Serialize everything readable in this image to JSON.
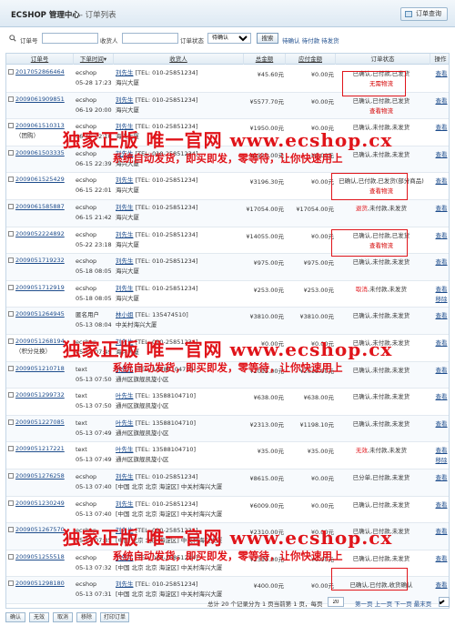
{
  "header": {
    "title": "ECSHOP 管理中心",
    "subtitle": "- 订单列表",
    "list_button": "订单查询"
  },
  "search": {
    "order_sn_label": "订单号",
    "consignee_label": "收货人",
    "status_label": "订单状态",
    "status_value": "待确认",
    "search_button": "搜索",
    "quick_links": "待确认 待付款 待发货"
  },
  "columns": {
    "order_sn": "订单号",
    "order_time": "下单时间",
    "consignee": "收货人",
    "total": "总金额",
    "payable": "应付金额",
    "status": "订单状态",
    "action": "操作"
  },
  "orders": [
    {
      "sn": "2017052866464",
      "extra": "",
      "buyer": "ecshop",
      "time": "05-28 17:23",
      "consignee": "刘先生",
      "tel": "[TEL: 010-25851234]",
      "addr": "海兴大厦",
      "total": "¥45.60元",
      "payable": "¥0.00元",
      "status": "已确认,已付款,已发货",
      "status2": "无需物流",
      "status2_red": false,
      "actions": [
        "查看"
      ]
    },
    {
      "sn": "2009061909851",
      "extra": "",
      "buyer": "ecshop",
      "time": "06-19 20:00",
      "consignee": "刘先生",
      "tel": "[TEL: 010-25851234]",
      "addr": "海兴大厦",
      "total": "¥5577.70元",
      "payable": "¥0.00元",
      "status": "已确认,已付款,已发货",
      "status2": "查看物流",
      "status2_red": true,
      "actions": [
        "查看"
      ]
    },
    {
      "sn": "2009061510313",
      "extra": "（团购）",
      "buyer": "ecshop",
      "time": "06-15 22:10",
      "consignee": "刘先生",
      "tel": "[TEL: 010-25851234]",
      "addr": "海兴大厦",
      "total": "¥1950.00元",
      "payable": "¥0.00元",
      "status": "已确认,未付款,未发货",
      "status2": "",
      "status2_red": false,
      "actions": [
        "查看"
      ]
    },
    {
      "sn": "2009061503335",
      "extra": "",
      "buyer": "ecshop",
      "time": "06-15 22:39",
      "consignee": "刘先生",
      "tel": "[TEL: 010-25851234]",
      "addr": "海兴大厦",
      "total": "¥1910.00元",
      "payable": "¥0.00元",
      "status": "已确认,未付款,未发货",
      "status2": "",
      "status2_red": false,
      "actions": [
        "查看"
      ]
    },
    {
      "sn": "2009061525429",
      "extra": "",
      "buyer": "ecshop",
      "time": "06-15 22:01",
      "consignee": "刘先生",
      "tel": "[TEL: 010-25851234]",
      "addr": "海兴大厦",
      "total": "¥3196.30元",
      "payable": "¥0.00元",
      "status": "已确认,已付款,已发货(部分商品)",
      "status2": "查看物流",
      "status2_red": true,
      "actions": [
        "查看"
      ]
    },
    {
      "sn": "2009061585887",
      "extra": "",
      "buyer": "ecshop",
      "time": "06-15 21:42",
      "consignee": "刘先生",
      "tel": "[TEL: 010-25851234]",
      "addr": "海兴大厦",
      "total": "¥17054.00元",
      "payable": "¥17054.00元",
      "status": "退货,未付款,未发货",
      "status2": "",
      "status2_red": false,
      "status_prefix": "退货",
      "actions": [
        "查看"
      ]
    },
    {
      "sn": "2009052224892",
      "extra": "",
      "buyer": "ecshop",
      "time": "05-22 23:18",
      "consignee": "刘先生",
      "tel": "[TEL: 010-25851234]",
      "addr": "海兴大厦",
      "total": "¥14055.00元",
      "payable": "¥0.00元",
      "status": "已确认,已付款,已发货",
      "status2": "查看物流",
      "status2_red": true,
      "actions": [
        "查看"
      ]
    },
    {
      "sn": "2009051719232",
      "extra": "",
      "buyer": "ecshop",
      "time": "05-18 08:05",
      "consignee": "刘先生",
      "tel": "[TEL: 010-25851234]",
      "addr": "海兴大厦",
      "total": "¥975.00元",
      "payable": "¥975.00元",
      "status": "已确认,未付款,未发货",
      "status2": "",
      "status2_red": false,
      "actions": [
        "查看"
      ]
    },
    {
      "sn": "2009051712919",
      "extra": "",
      "buyer": "ecshop",
      "time": "05-18 08:05",
      "consignee": "刘先生",
      "tel": "[TEL: 010-25851234]",
      "addr": "海兴大厦",
      "total": "¥253.00元",
      "payable": "¥253.00元",
      "status": "取消,未付款,未发货",
      "status2": "",
      "status2_red": false,
      "status_prefix": "取消",
      "actions": [
        "查看",
        "移除"
      ]
    },
    {
      "sn": "2009051264945",
      "extra": "",
      "buyer": "匿名用户",
      "time": "05-13 08:04",
      "consignee": "林小姐",
      "tel": "[TEL: 135474510]",
      "addr": "中关村海兴大厦",
      "total": "¥3810.00元",
      "payable": "¥3810.00元",
      "status": "已确认,未付款,未发货",
      "status2": "",
      "status2_red": false,
      "actions": [
        "查看"
      ]
    },
    {
      "sn": "2009051268194",
      "extra": "（积分兑换）",
      "buyer": "ecshop",
      "time": "05-13 07:49",
      "consignee": "刘先生",
      "tel": "[TEL: 010-25851234]",
      "addr": "海兴大厦",
      "total": "¥0.00元",
      "payable": "¥0.00元",
      "status": "已确认,未付款,未发货",
      "status2": "",
      "status2_red": false,
      "actions": [
        "查看"
      ]
    },
    {
      "sn": "2009051210718",
      "extra": "",
      "buyer": "text",
      "time": "05-13 07:50",
      "consignee": "叶先生",
      "tel": "[TEL: 13588104710]",
      "addr": "通州区旗舰凯旋小区",
      "total": "¥2015.00元",
      "payable": "¥2015.00元",
      "status": "已确认,未付款,未发货",
      "status2": "",
      "status2_red": false,
      "actions": [
        "查看"
      ]
    },
    {
      "sn": "2009051299732",
      "extra": "",
      "buyer": "text",
      "time": "05-13 07:50",
      "consignee": "叶先生",
      "tel": "[TEL: 13588104710]",
      "addr": "通州区旗舰凯旋小区",
      "total": "¥638.00元",
      "payable": "¥638.00元",
      "status": "已确认,未付款,未发货",
      "status2": "",
      "status2_red": false,
      "actions": [
        "查看"
      ]
    },
    {
      "sn": "2009051227085",
      "extra": "",
      "buyer": "text",
      "time": "05-13 07:49",
      "consignee": "叶先生",
      "tel": "[TEL: 13588104710]",
      "addr": "通州区旗舰凯旋小区",
      "total": "¥2313.00元",
      "payable": "¥1198.10元",
      "status": "已确认,未付款,未发货",
      "status2": "",
      "status2_red": false,
      "actions": [
        "查看"
      ]
    },
    {
      "sn": "2009051217221",
      "extra": "",
      "buyer": "text",
      "time": "05-13 07:49",
      "consignee": "叶先生",
      "tel": "[TEL: 13588104710]",
      "addr": "通州区旗舰凯旋小区",
      "total": "¥35.00元",
      "payable": "¥35.00元",
      "status": "无效,未付款,未发货",
      "status2": "",
      "status2_red": false,
      "status_prefix": "无效",
      "actions": [
        "查看",
        "移除"
      ]
    },
    {
      "sn": "2009051276258",
      "extra": "",
      "buyer": "ecshop",
      "time": "05-13 07:40",
      "consignee": "刘先生",
      "tel": "[TEL: 010-25851234]",
      "addr": "[中国 北京 北京 海淀区] 中关村海兴大厦",
      "total": "¥8615.00元",
      "payable": "¥0.00元",
      "status": "已分单,已付款,未发货",
      "status2": "",
      "status2_red": false,
      "actions": [
        "查看"
      ]
    },
    {
      "sn": "2009051230249",
      "extra": "",
      "buyer": "ecshop",
      "time": "05-13 07:40",
      "consignee": "刘先生",
      "tel": "[TEL: 010-25851234]",
      "addr": "[中国 北京 北京 海淀区] 中关村海兴大厦",
      "total": "¥6009.00元",
      "payable": "¥0.00元",
      "status": "已确认,已付款,未发货",
      "status2": "",
      "status2_red": false,
      "actions": [
        "查看"
      ]
    },
    {
      "sn": "2009051267570",
      "extra": "",
      "buyer": "ecshop",
      "time": "05-13 07:35",
      "consignee": "刘先生",
      "tel": "[TEL: 010-25851234]",
      "addr": "[中国 北京 北京 海淀区] 中关村海兴大厦",
      "total": "¥2310.00元",
      "payable": "¥0.00元",
      "status": "已确认,已付款,未发货",
      "status2": "",
      "status2_red": false,
      "actions": [
        "查看"
      ]
    },
    {
      "sn": "2009051255518",
      "extra": "",
      "buyer": "ecshop",
      "time": "05-13 07:32",
      "consignee": "刘先生",
      "tel": "[TEL: 010-25851234]",
      "addr": "[中国 北京 北京 海淀区] 中关村海兴大厦",
      "total": "¥2310.00元",
      "payable": "¥0.00元",
      "status": "已确认,已付款,未发货",
      "status2": "",
      "status2_red": false,
      "actions": [
        "查看"
      ]
    },
    {
      "sn": "2009051298180",
      "extra": "",
      "buyer": "ecshop",
      "time": "05-13 07:31",
      "consignee": "刘先生",
      "tel": "[TEL: 010-25851234]",
      "addr": "[中国 北京 北京 海淀区] 中关村海兴大厦",
      "total": "¥400.00元",
      "payable": "¥0.00元",
      "status": "已确认,已付款,收货确认",
      "status2": "",
      "status2_red": false,
      "actions": [
        "查看"
      ]
    }
  ],
  "pager": {
    "info_before": "总计 20 个记录分为 1 页当前第 1 页，每页",
    "per_page": "20",
    "links": "第一页 上一页 下一页 最末页",
    "page_select": "1"
  },
  "footer": {
    "confirm": "确认",
    "invalid": "无效",
    "cancel": "取消",
    "remove": "移除",
    "print": "打印订单"
  },
  "watermark": {
    "line1": "独家正版 唯一官网 www.ecshop.cx",
    "line2": "系统自动发货，即买即发，零等待，让你快速用上"
  },
  "colors": {
    "accent_red": "#e0141a",
    "link_blue": "#1d4c8c",
    "header_bg": "#dde9f3"
  }
}
